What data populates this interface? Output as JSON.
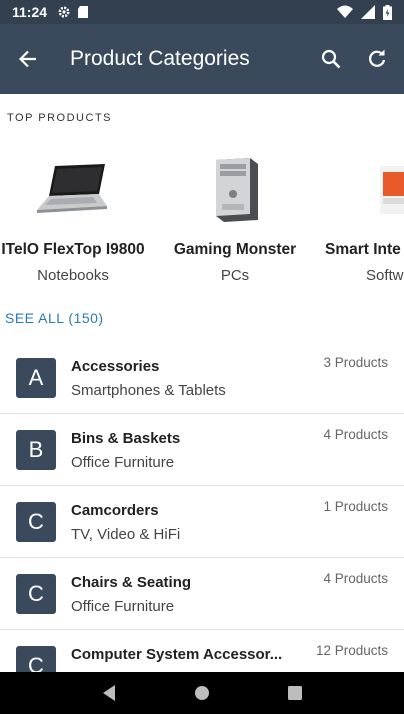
{
  "status_bar": {
    "time": "11:24"
  },
  "app_bar": {
    "title": "Product Categories"
  },
  "top_products": {
    "header": "TOP PRODUCTS",
    "items": [
      {
        "name": "ITelO FlexTop I9800",
        "category": "Notebooks"
      },
      {
        "name": "Gaming Monster",
        "category": "PCs"
      },
      {
        "name": "Smart Inte",
        "category": "Softw"
      }
    ],
    "see_all": "SEE ALL (150)"
  },
  "categories": [
    {
      "letter": "A",
      "title": "Accessories",
      "subtitle": "Smartphones & Tablets",
      "count": "3 Products"
    },
    {
      "letter": "B",
      "title": "Bins & Baskets",
      "subtitle": "Office Furniture",
      "count": "4 Products"
    },
    {
      "letter": "C",
      "title": "Camcorders",
      "subtitle": "TV, Video & HiFi",
      "count": "1 Products"
    },
    {
      "letter": "C",
      "title": "Chairs & Seating",
      "subtitle": "Office Furniture",
      "count": "4 Products"
    },
    {
      "letter": "C",
      "title": "Computer System Accessor...",
      "subtitle": "",
      "count": "12 Products"
    }
  ],
  "colors": {
    "app_bar": "#3a4a5c",
    "status_bar": "#32404f",
    "link": "#2a7ab8",
    "avatar": "#3a4a5c"
  }
}
